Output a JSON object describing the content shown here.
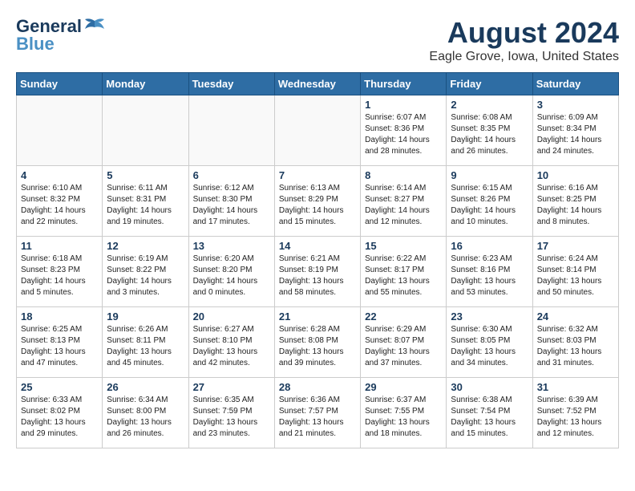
{
  "header": {
    "logo_general": "General",
    "logo_blue": "Blue",
    "title": "August 2024",
    "subtitle": "Eagle Grove, Iowa, United States"
  },
  "weekdays": [
    "Sunday",
    "Monday",
    "Tuesday",
    "Wednesday",
    "Thursday",
    "Friday",
    "Saturday"
  ],
  "weeks": [
    [
      {
        "day": "",
        "info": ""
      },
      {
        "day": "",
        "info": ""
      },
      {
        "day": "",
        "info": ""
      },
      {
        "day": "",
        "info": ""
      },
      {
        "day": "1",
        "info": "Sunrise: 6:07 AM\nSunset: 8:36 PM\nDaylight: 14 hours\nand 28 minutes."
      },
      {
        "day": "2",
        "info": "Sunrise: 6:08 AM\nSunset: 8:35 PM\nDaylight: 14 hours\nand 26 minutes."
      },
      {
        "day": "3",
        "info": "Sunrise: 6:09 AM\nSunset: 8:34 PM\nDaylight: 14 hours\nand 24 minutes."
      }
    ],
    [
      {
        "day": "4",
        "info": "Sunrise: 6:10 AM\nSunset: 8:32 PM\nDaylight: 14 hours\nand 22 minutes."
      },
      {
        "day": "5",
        "info": "Sunrise: 6:11 AM\nSunset: 8:31 PM\nDaylight: 14 hours\nand 19 minutes."
      },
      {
        "day": "6",
        "info": "Sunrise: 6:12 AM\nSunset: 8:30 PM\nDaylight: 14 hours\nand 17 minutes."
      },
      {
        "day": "7",
        "info": "Sunrise: 6:13 AM\nSunset: 8:29 PM\nDaylight: 14 hours\nand 15 minutes."
      },
      {
        "day": "8",
        "info": "Sunrise: 6:14 AM\nSunset: 8:27 PM\nDaylight: 14 hours\nand 12 minutes."
      },
      {
        "day": "9",
        "info": "Sunrise: 6:15 AM\nSunset: 8:26 PM\nDaylight: 14 hours\nand 10 minutes."
      },
      {
        "day": "10",
        "info": "Sunrise: 6:16 AM\nSunset: 8:25 PM\nDaylight: 14 hours\nand 8 minutes."
      }
    ],
    [
      {
        "day": "11",
        "info": "Sunrise: 6:18 AM\nSunset: 8:23 PM\nDaylight: 14 hours\nand 5 minutes."
      },
      {
        "day": "12",
        "info": "Sunrise: 6:19 AM\nSunset: 8:22 PM\nDaylight: 14 hours\nand 3 minutes."
      },
      {
        "day": "13",
        "info": "Sunrise: 6:20 AM\nSunset: 8:20 PM\nDaylight: 14 hours\nand 0 minutes."
      },
      {
        "day": "14",
        "info": "Sunrise: 6:21 AM\nSunset: 8:19 PM\nDaylight: 13 hours\nand 58 minutes."
      },
      {
        "day": "15",
        "info": "Sunrise: 6:22 AM\nSunset: 8:17 PM\nDaylight: 13 hours\nand 55 minutes."
      },
      {
        "day": "16",
        "info": "Sunrise: 6:23 AM\nSunset: 8:16 PM\nDaylight: 13 hours\nand 53 minutes."
      },
      {
        "day": "17",
        "info": "Sunrise: 6:24 AM\nSunset: 8:14 PM\nDaylight: 13 hours\nand 50 minutes."
      }
    ],
    [
      {
        "day": "18",
        "info": "Sunrise: 6:25 AM\nSunset: 8:13 PM\nDaylight: 13 hours\nand 47 minutes."
      },
      {
        "day": "19",
        "info": "Sunrise: 6:26 AM\nSunset: 8:11 PM\nDaylight: 13 hours\nand 45 minutes."
      },
      {
        "day": "20",
        "info": "Sunrise: 6:27 AM\nSunset: 8:10 PM\nDaylight: 13 hours\nand 42 minutes."
      },
      {
        "day": "21",
        "info": "Sunrise: 6:28 AM\nSunset: 8:08 PM\nDaylight: 13 hours\nand 39 minutes."
      },
      {
        "day": "22",
        "info": "Sunrise: 6:29 AM\nSunset: 8:07 PM\nDaylight: 13 hours\nand 37 minutes."
      },
      {
        "day": "23",
        "info": "Sunrise: 6:30 AM\nSunset: 8:05 PM\nDaylight: 13 hours\nand 34 minutes."
      },
      {
        "day": "24",
        "info": "Sunrise: 6:32 AM\nSunset: 8:03 PM\nDaylight: 13 hours\nand 31 minutes."
      }
    ],
    [
      {
        "day": "25",
        "info": "Sunrise: 6:33 AM\nSunset: 8:02 PM\nDaylight: 13 hours\nand 29 minutes."
      },
      {
        "day": "26",
        "info": "Sunrise: 6:34 AM\nSunset: 8:00 PM\nDaylight: 13 hours\nand 26 minutes."
      },
      {
        "day": "27",
        "info": "Sunrise: 6:35 AM\nSunset: 7:59 PM\nDaylight: 13 hours\nand 23 minutes."
      },
      {
        "day": "28",
        "info": "Sunrise: 6:36 AM\nSunset: 7:57 PM\nDaylight: 13 hours\nand 21 minutes."
      },
      {
        "day": "29",
        "info": "Sunrise: 6:37 AM\nSunset: 7:55 PM\nDaylight: 13 hours\nand 18 minutes."
      },
      {
        "day": "30",
        "info": "Sunrise: 6:38 AM\nSunset: 7:54 PM\nDaylight: 13 hours\nand 15 minutes."
      },
      {
        "day": "31",
        "info": "Sunrise: 6:39 AM\nSunset: 7:52 PM\nDaylight: 13 hours\nand 12 minutes."
      }
    ]
  ]
}
